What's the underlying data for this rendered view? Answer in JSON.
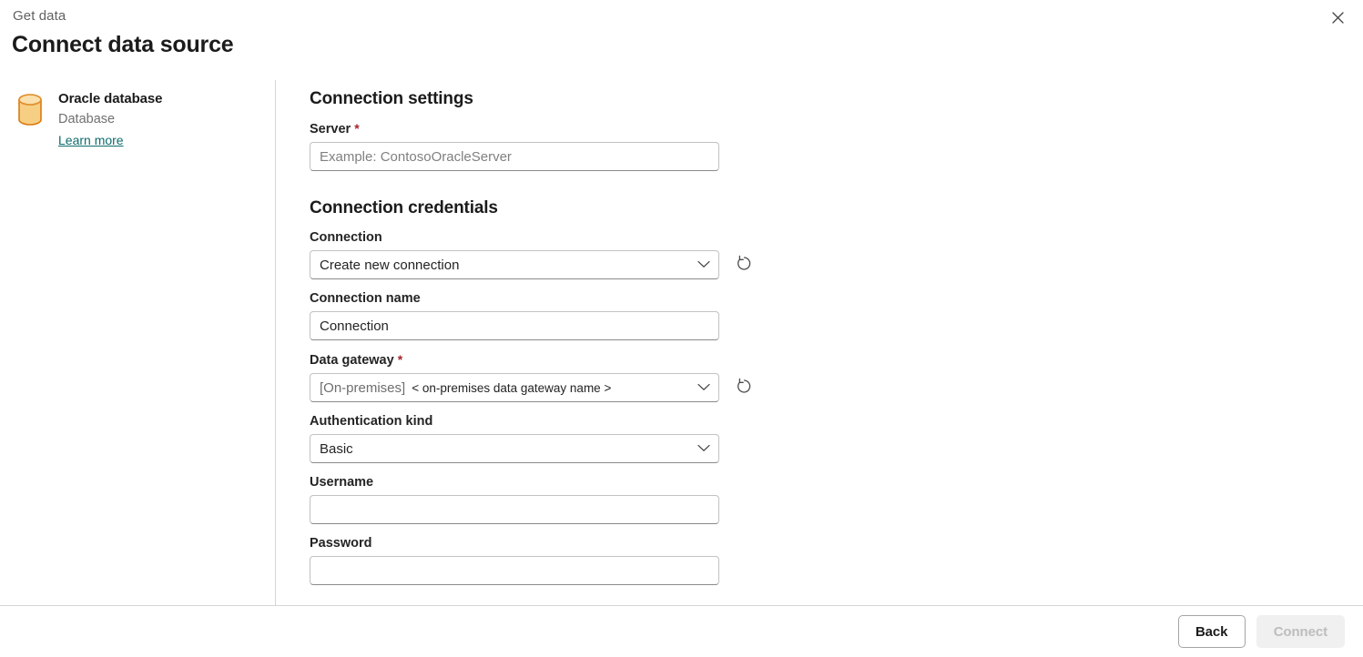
{
  "header": {
    "breadcrumb": "Get data",
    "title": "Connect data source",
    "close_icon": "close-icon"
  },
  "source": {
    "icon": "database-cylinder-icon",
    "name": "Oracle database",
    "category": "Database",
    "learn_more": "Learn more",
    "icon_color": "#f5c26b",
    "icon_stroke": "#d97b10"
  },
  "form": {
    "settings_heading": "Connection settings",
    "credentials_heading": "Connection credentials",
    "required_marker": "*",
    "server": {
      "label": "Server",
      "required": true,
      "value": "",
      "placeholder": "Example: ContosoOracleServer"
    },
    "connection": {
      "label": "Connection",
      "required": false,
      "value": "Create new connection",
      "refresh_icon": "refresh-icon"
    },
    "connection_name": {
      "label": "Connection name",
      "required": false,
      "value": "Connection",
      "placeholder": ""
    },
    "data_gateway": {
      "label": "Data gateway",
      "required": true,
      "value_prefix": "[On-premises]",
      "value_name": "< on-premises data gateway name >",
      "refresh_icon": "refresh-icon"
    },
    "authentication_kind": {
      "label": "Authentication kind",
      "required": false,
      "value": "Basic"
    },
    "username": {
      "label": "Username",
      "required": false,
      "value": "",
      "placeholder": ""
    },
    "password": {
      "label": "Password",
      "required": false,
      "value": "",
      "placeholder": ""
    }
  },
  "footer": {
    "back_label": "Back",
    "connect_label": "Connect"
  },
  "colors": {
    "required_red": "#a4262c",
    "link_teal": "#0f6b6b",
    "divider": "#d6d6d6"
  }
}
